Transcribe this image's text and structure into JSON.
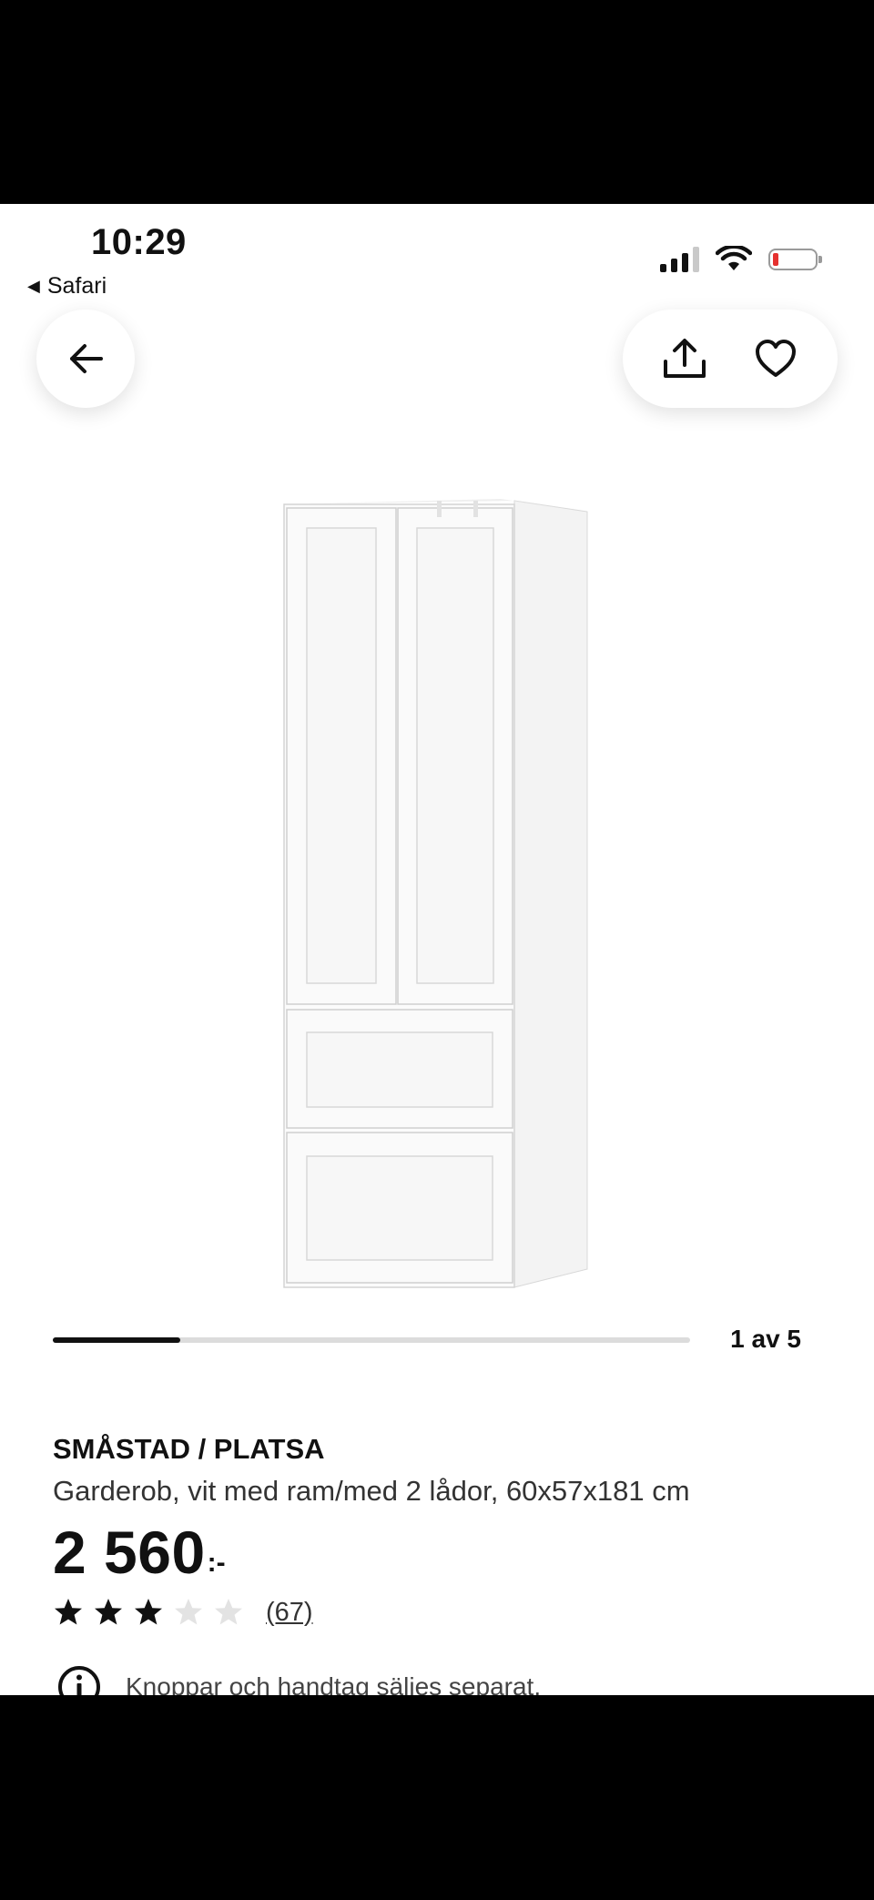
{
  "status_bar": {
    "time": "10:29",
    "back_app_label": "Safari",
    "battery_color": "#e5312f"
  },
  "nav": {
    "back_icon": "arrow-left-icon",
    "share_icon": "share-icon",
    "favorite_icon": "heart-icon"
  },
  "gallery": {
    "pager_text": "1 av 5",
    "current": 1,
    "total": 5
  },
  "product": {
    "name": "SMÅSTAD / PLATSA",
    "description": "Garderob, vit med ram/med 2 lådor, 60x57x181 cm",
    "price": "2 560",
    "price_suffix": ":-",
    "rating": 3,
    "rating_max": 5,
    "review_count": "(67)",
    "notice": "Knoppar och handtag säljes separat."
  }
}
